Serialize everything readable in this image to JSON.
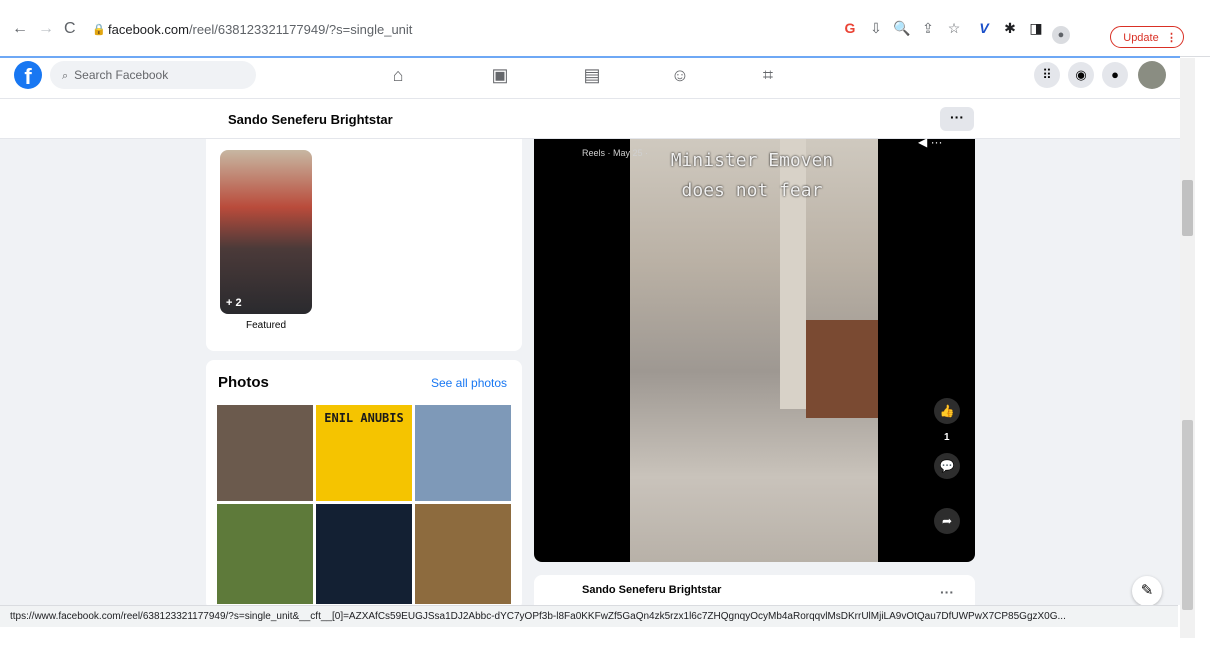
{
  "browser": {
    "url_host": "facebook.com",
    "url_path": "/reel/638123321177949/?s=single_unit",
    "update_label": "Update",
    "icons": [
      "back-icon",
      "forward-icon",
      "reload-icon",
      "lock-icon",
      "google-icon",
      "install-icon",
      "zoom-icon",
      "share-icon",
      "star-icon",
      "vimeo-icon",
      "extensions-icon",
      "sidepanel-icon",
      "profile-icon"
    ]
  },
  "fb": {
    "search_placeholder": "Search Facebook",
    "nav_icons": [
      "home-icon",
      "watch-icon",
      "marketplace-icon",
      "groups-icon",
      "gaming-icon"
    ],
    "right_icons": [
      "menu-grid-icon",
      "messenger-icon",
      "notifications-icon",
      "account-avatar"
    ]
  },
  "page": {
    "name": "Sando Seneferu Brightstar",
    "more_label": "···"
  },
  "featured": {
    "count_label": "+ 2",
    "label": "Featured"
  },
  "photos": {
    "title": "Photos",
    "see_all": "See all photos",
    "items": [
      {
        "desc": "photo-tshirt",
        "color": "#6b5a4d",
        "text": ""
      },
      {
        "desc": "photo-anubis",
        "color": "#f5c400",
        "text": "ENIL ANUBIS"
      },
      {
        "desc": "photo-statue",
        "color": "#7e99b8",
        "text": ""
      },
      {
        "desc": "photo-field",
        "color": "#5e7a3a",
        "text": ""
      },
      {
        "desc": "photo-dark",
        "color": "#132033",
        "text": ""
      },
      {
        "desc": "photo-ceremony",
        "color": "#8d6b3e",
        "text": ""
      }
    ]
  },
  "reel": {
    "meta": "Reels · May 25 · ",
    "caption_line1": "Minister Emoven",
    "caption_line2": "does not fear",
    "like_count": "1"
  },
  "post": {
    "author": "Sando Seneferu Brightstar",
    "more_label": "···"
  },
  "status_url": "ttps://www.facebook.com/reel/638123321177949/?s=single_unit&__cft__[0]=AZXAfCs59EUGJSsa1DJ2Abbc-dYC7yOPf3b-l8Fa0KKFwZf5GaQn4zk5rzx1l6c7ZHQgnqyOcyMb4aRorqqvlMsDKrrUlMjiLA9vOtQau7DfUWPwX7CP85GgzX0G..."
}
